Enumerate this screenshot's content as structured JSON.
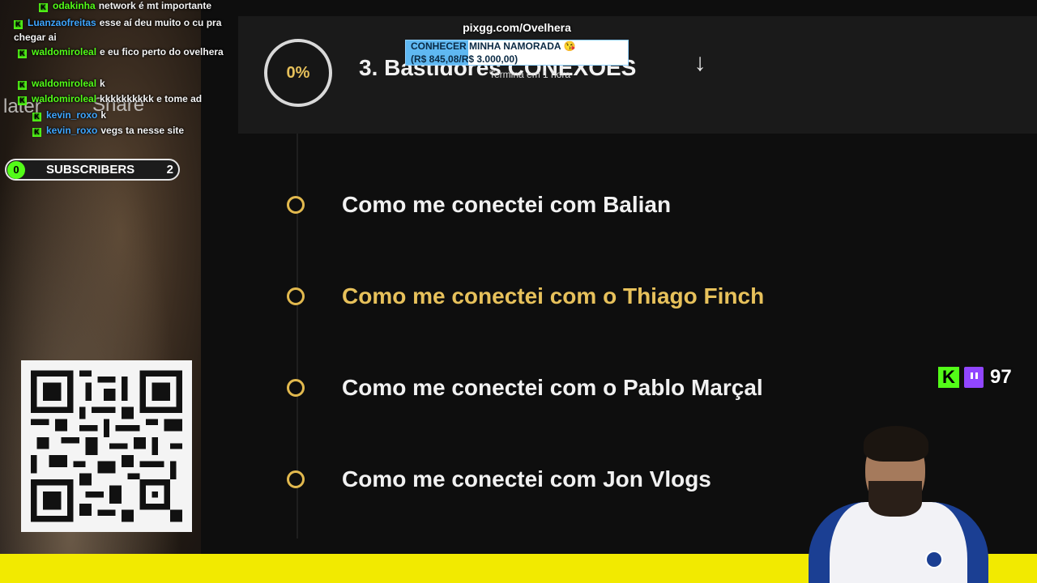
{
  "chat": {
    "lines": [
      {
        "user": "odakinha",
        "message": "network é mt importante"
      },
      {
        "user": "Luanzaofreitas",
        "message": "esse aí deu muito o cu pra chegar ai"
      },
      {
        "user": "waldomiroleal",
        "message": "e eu fico perto do ovelhera"
      },
      {
        "user": "waldomiroleal",
        "message": "k"
      },
      {
        "user": "waldomiroleal",
        "message": "kkkkkkkkkk e tome ad"
      },
      {
        "user": "kevin_roxo",
        "message": "k"
      },
      {
        "user": "kevin_roxo",
        "message": "vegs ta nesse site"
      }
    ],
    "ghost_later": "later",
    "ghost_share": "Share"
  },
  "subscribers": {
    "current": "0",
    "label": "SUBSCRIBERS",
    "goal": "2"
  },
  "donation": {
    "url": "pixgg.com/Ovelhera",
    "goal_title": "CONHECER MINHA NAMORADA 😘",
    "goal_amount": "(R$ 845,08/R$ 3.000,00)",
    "goal_progress": 0.28,
    "ends_in": "Termina em 1 hora"
  },
  "course": {
    "progress": "0%",
    "module_title": "3. Bastidores CONEXÕES",
    "lessons": [
      {
        "title": "Como me conectei com Balian",
        "active": false
      },
      {
        "title": "Como me conectei com o Thiago Finch",
        "active": true
      },
      {
        "title": "Como me conectei com o Pablo Marçal",
        "active": false
      },
      {
        "title": "Como me conectei com Jon Vlogs",
        "active": false
      }
    ]
  },
  "viewers": {
    "count": "97",
    "kick_icon": "kick-logo-icon",
    "twitch_icon": "twitch-logo-icon"
  },
  "colors": {
    "accent": "#e7c15b",
    "kick": "#53fc18",
    "twitch": "#9146ff",
    "bottom_bar": "#f2ea00"
  }
}
